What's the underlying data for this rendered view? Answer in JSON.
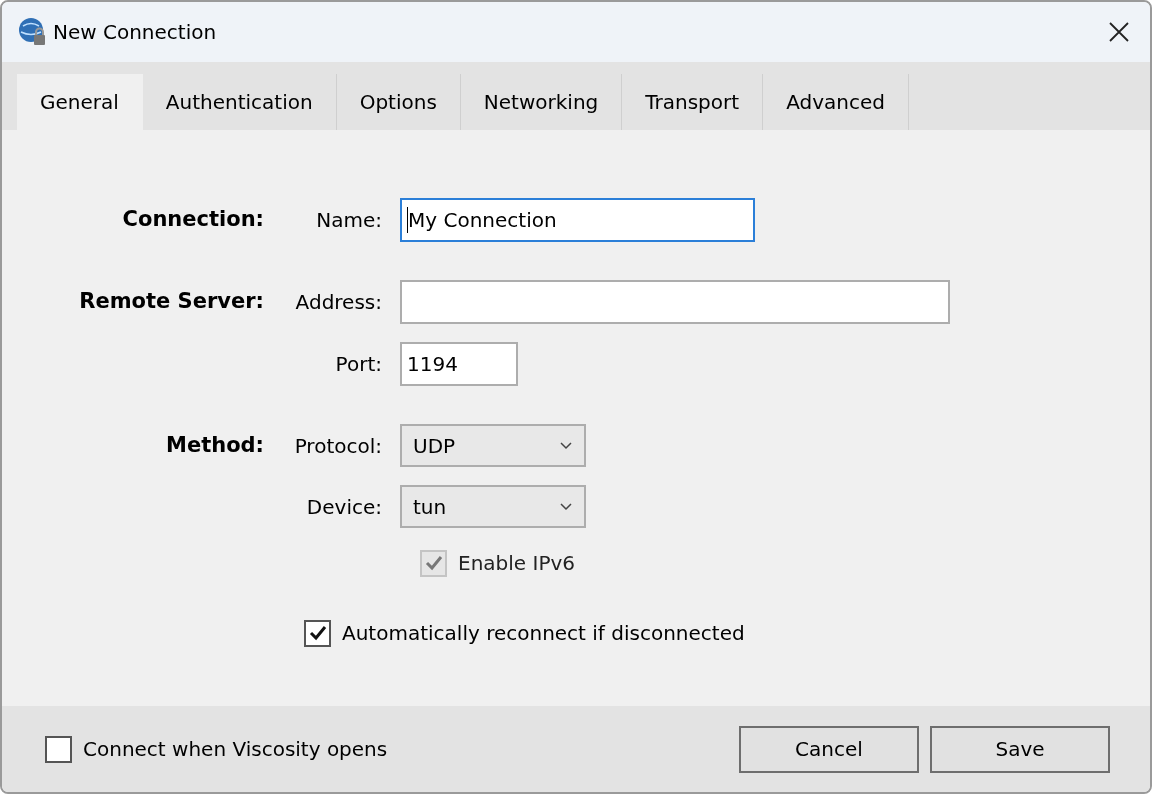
{
  "window": {
    "title": "New Connection"
  },
  "tabs": [
    {
      "label": "General",
      "selected": true
    },
    {
      "label": "Authentication",
      "selected": false
    },
    {
      "label": "Options",
      "selected": false
    },
    {
      "label": "Networking",
      "selected": false
    },
    {
      "label": "Transport",
      "selected": false
    },
    {
      "label": "Advanced",
      "selected": false
    }
  ],
  "sections": [
    {
      "label": "Connection:",
      "fields": [
        {
          "kind": "text",
          "label": "Name:",
          "value": "My Connection",
          "focused": true
        }
      ]
    },
    {
      "label": "Remote Server:",
      "fields": [
        {
          "kind": "text",
          "label": "Address:",
          "focused": false
        },
        {
          "kind": "text",
          "label": "Port:",
          "value": "1194",
          "focused": false
        }
      ]
    },
    {
      "label": "Method:",
      "fields": [
        {
          "kind": "dropdown",
          "label": "Protocol:",
          "value": "UDP"
        },
        {
          "kind": "dropdown",
          "label": "Device:",
          "value": "tun"
        },
        {
          "kind": "checkbox",
          "text": "Enable IPv6",
          "checked": true,
          "disabled": true
        }
      ]
    }
  ],
  "auto_reconnect": {
    "text": "Automatically reconnect if disconnected",
    "checked": true,
    "disabled": false
  },
  "footer": {
    "connect_on_open": {
      "text": "Connect when Viscosity opens",
      "checked": false,
      "disabled": false
    },
    "buttons": [
      "Cancel",
      "Save"
    ]
  }
}
